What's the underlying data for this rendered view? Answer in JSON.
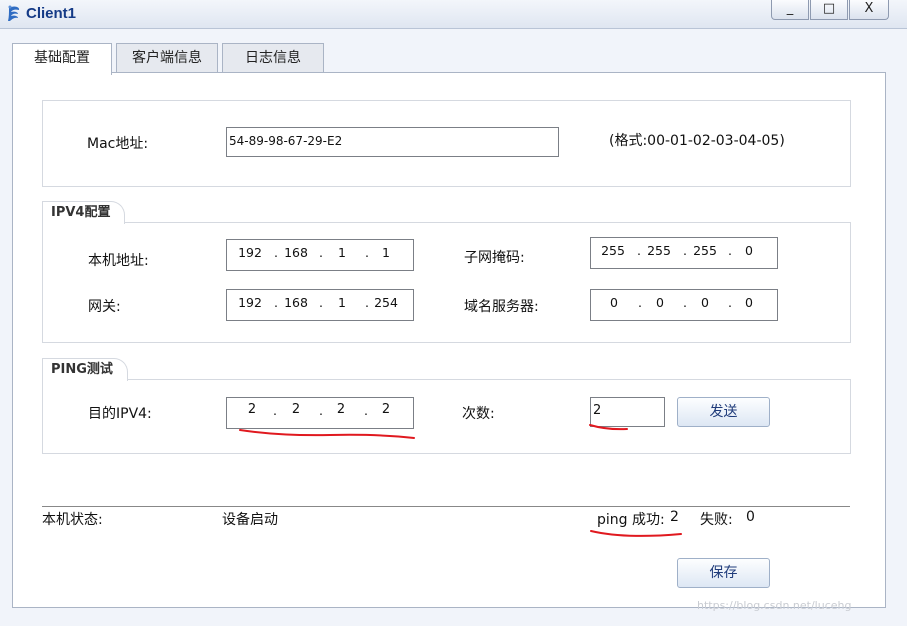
{
  "window": {
    "title": "Client1",
    "controls": {
      "minimize": "_",
      "maximize": "□",
      "close": "X"
    }
  },
  "tabs": [
    {
      "label": "基础配置",
      "active": true
    },
    {
      "label": "客户端信息",
      "active": false
    },
    {
      "label": "日志信息",
      "active": false
    }
  ],
  "mac": {
    "label": "Mac地址:",
    "value": "54-89-98-67-29-E2",
    "format_hint": "(格式:00-01-02-03-04-05)"
  },
  "ipv4": {
    "legend": "IPV4配置",
    "local_ip_label": "本机地址:",
    "local_ip": [
      "192",
      "168",
      "1",
      "1"
    ],
    "subnet_label": "子网掩码:",
    "subnet": [
      "255",
      "255",
      "255",
      "0"
    ],
    "gateway_label": "网关:",
    "gateway": [
      "192",
      "168",
      "1",
      "254"
    ],
    "dns_label": "域名服务器:",
    "dns": [
      "0",
      "0",
      "0",
      "0"
    ]
  },
  "ping": {
    "legend": "PING测试",
    "dest_label": "目的IPV4:",
    "dest": [
      "2",
      "2",
      "2",
      "2"
    ],
    "count_label": "次数:",
    "count": "2",
    "send_label": "发送"
  },
  "status": {
    "label": "本机状态:",
    "value": "设备启动",
    "ping_success_label": "ping 成功:",
    "ping_success": "2",
    "ping_fail_label": "失败:",
    "ping_fail": "0"
  },
  "save_label": "保存",
  "watermark": "https://blog.csdn.net/lucehg",
  "colors": {
    "title": "#143a86",
    "annotation": "#e0191f",
    "button_text": "#1f3b7a"
  }
}
